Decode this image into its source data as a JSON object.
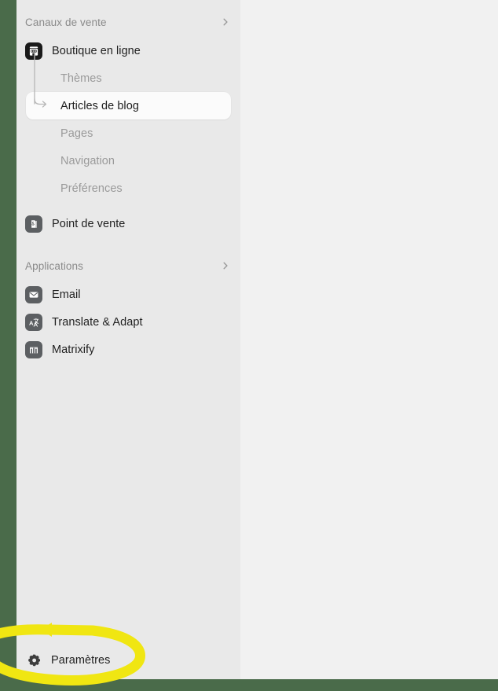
{
  "window": {
    "app": "Shopify admin",
    "left_rail_color": "#4a6b4a",
    "sidebar_background": "#e9e9e9",
    "content_background": "#f1f1f1"
  },
  "sidebar": {
    "sections": [
      {
        "title": "Canaux de vente",
        "chevron_icon": "chevron-right-icon",
        "items": [
          {
            "label": "Boutique en ligne",
            "icon": "online-store-icon",
            "icon_style": "dark",
            "type": "top",
            "children": [
              {
                "label": "Thèmes",
                "selected": false
              },
              {
                "label": "Articles de blog",
                "selected": true
              },
              {
                "label": "Pages",
                "selected": false
              },
              {
                "label": "Navigation",
                "selected": false
              },
              {
                "label": "Préférences",
                "selected": false
              }
            ]
          },
          {
            "label": "Point de vente",
            "icon": "point-of-sale-icon",
            "icon_style": "gray",
            "type": "top",
            "children": []
          }
        ]
      },
      {
        "title": "Applications",
        "chevron_icon": "chevron-right-icon",
        "items": [
          {
            "label": "Email",
            "icon": "envelope-icon",
            "icon_style": "gray",
            "type": "top",
            "children": []
          },
          {
            "label": "Translate & Adapt",
            "icon": "translate-icon",
            "icon_style": "gray",
            "type": "top",
            "children": []
          },
          {
            "label": "Matrixify",
            "icon": "matrixify-icon",
            "icon_style": "gray",
            "type": "top",
            "children": []
          }
        ]
      }
    ],
    "settings": {
      "label": "Paramètres",
      "icon": "gear-icon"
    }
  },
  "annotation": {
    "type": "hand-drawn-ellipse",
    "color": "#f0e612",
    "target": "Paramètres"
  }
}
